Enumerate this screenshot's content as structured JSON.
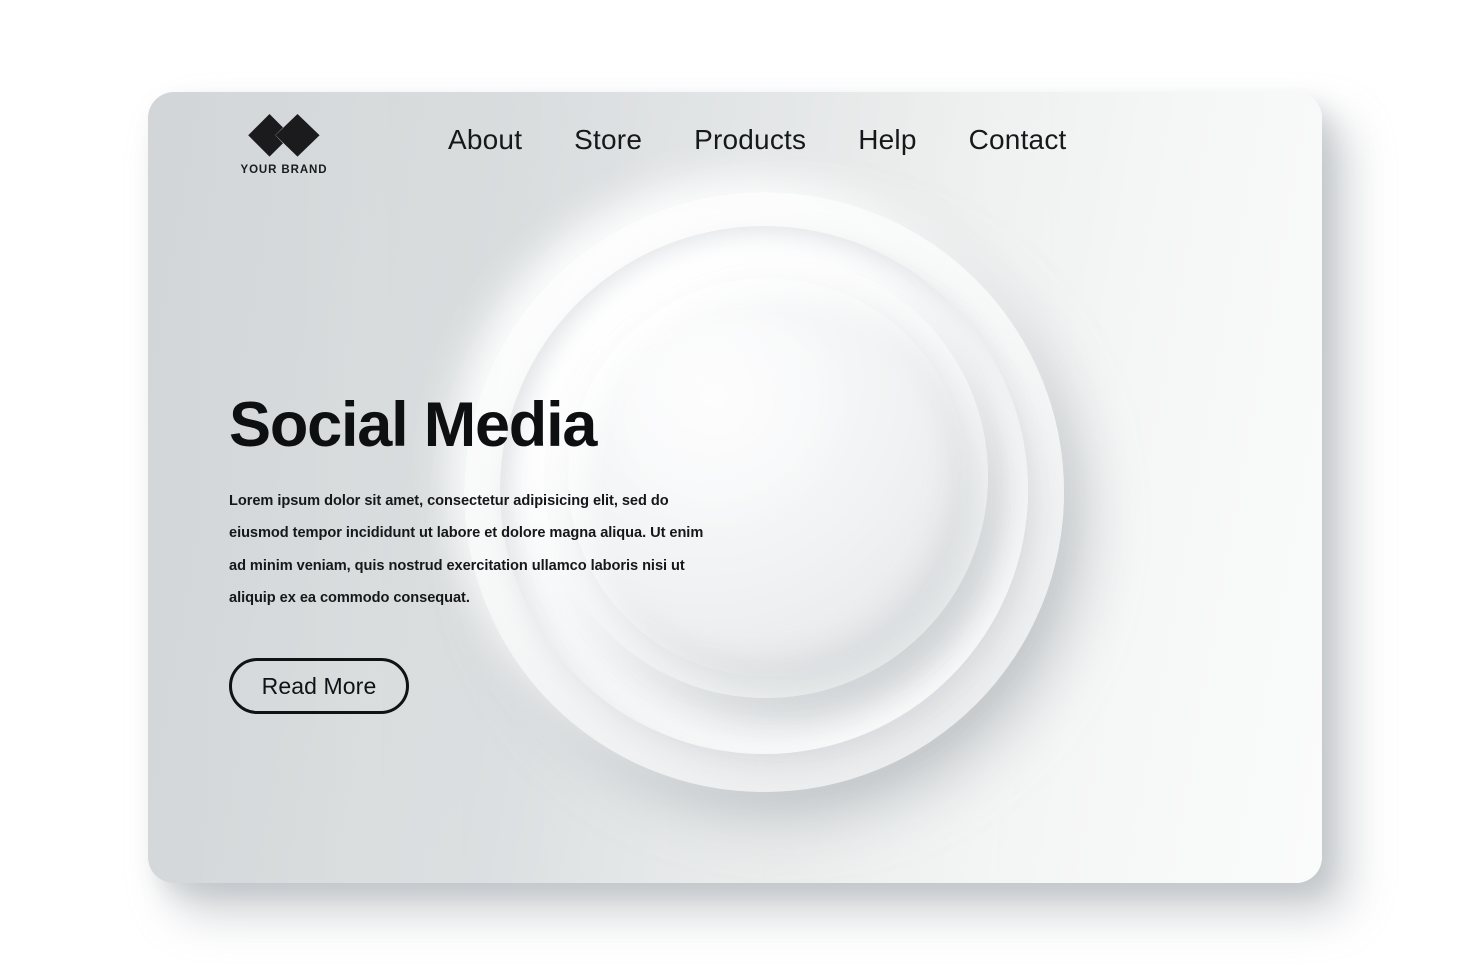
{
  "page": {
    "background_color": "#ffffff"
  },
  "card": {
    "gradient_from": "#d2d6d8",
    "gradient_to": "#fafbfb",
    "corner_radius_px": 26
  },
  "header": {
    "brand": {
      "logo_icon": "double-diamond-logo-icon",
      "name": "YOUR BRAND",
      "color": "#1b1b1d"
    },
    "nav": [
      {
        "label": "About"
      },
      {
        "label": "Store"
      },
      {
        "label": "Products"
      },
      {
        "label": "Help"
      },
      {
        "label": "Contact"
      }
    ]
  },
  "hero": {
    "title": "Social Media",
    "title_color": "#0e0f11",
    "paragraph": "Lorem ipsum dolor sit amet, consectetur adipisicing elit, sed do eiusmod tempor incididunt ut labore et dolore magna aliqua. Ut enim ad minim veniam, quis nostrud exercitation ullamco laboris nisi ut aliquip ex ea commodo consequat.",
    "cta_label": "Read More",
    "cta_border_color": "#111214"
  },
  "decoration": {
    "shape": "neumorphic-concentric-circles",
    "layer_count": 4,
    "highlight_color": "#ffffff",
    "shadow_color": "#a5acb1"
  }
}
